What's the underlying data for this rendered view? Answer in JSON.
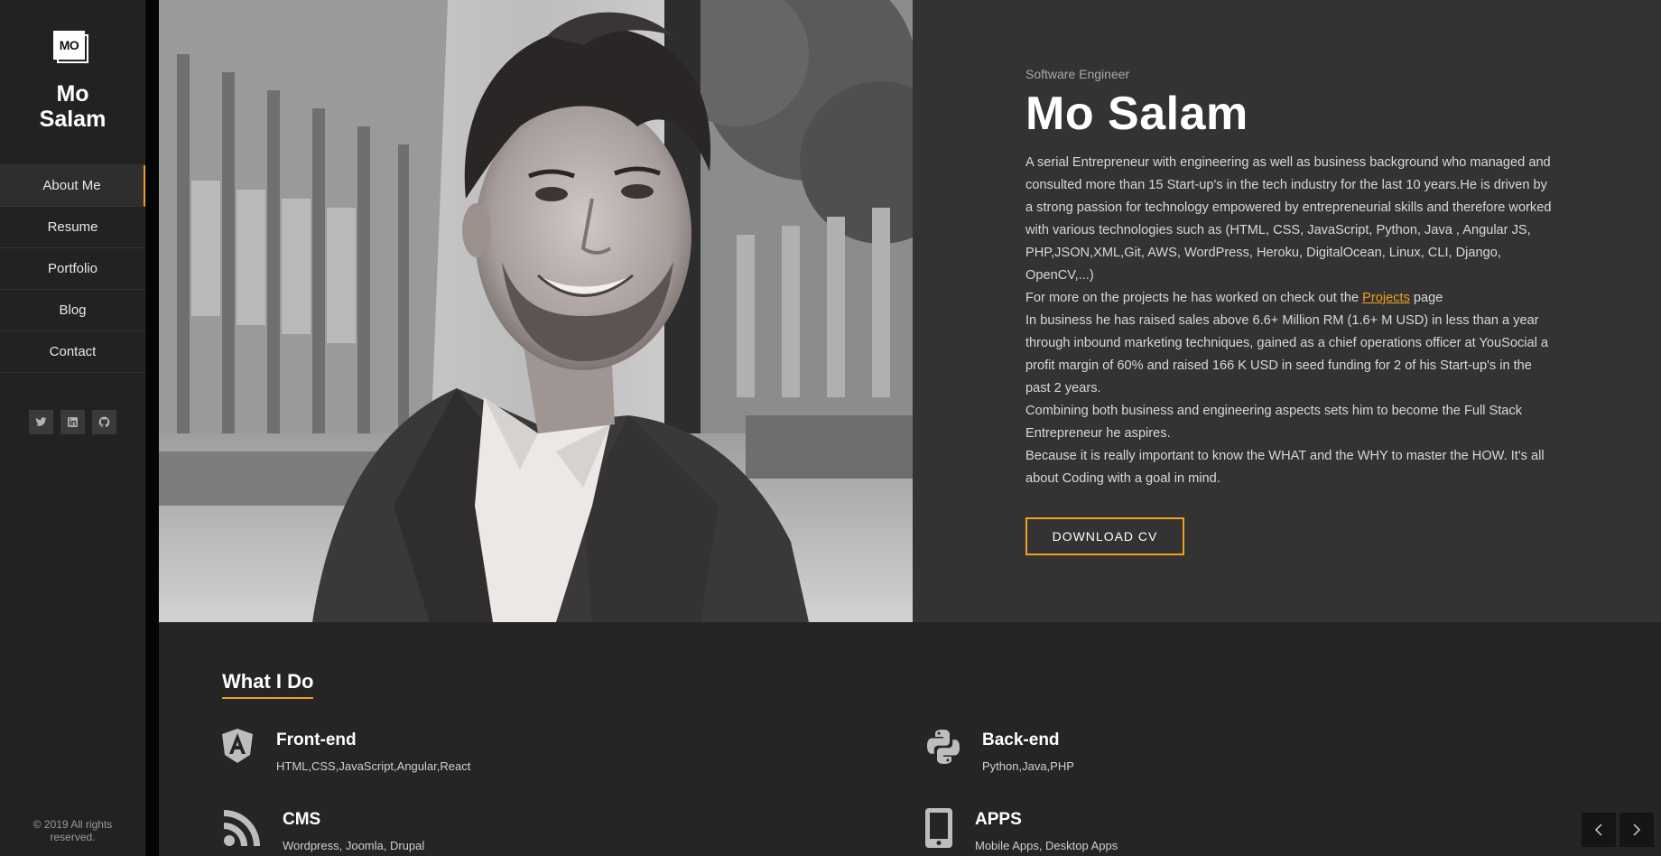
{
  "sidebar": {
    "logo_text": "MO",
    "brand_name": "Mo Salam",
    "nav": [
      {
        "label": "About Me",
        "active": true
      },
      {
        "label": "Resume",
        "active": false
      },
      {
        "label": "Portfolio",
        "active": false
      },
      {
        "label": "Blog",
        "active": false
      },
      {
        "label": "Contact",
        "active": false
      }
    ],
    "socials": [
      {
        "icon": "twitter-icon"
      },
      {
        "icon": "linkedin-icon"
      },
      {
        "icon": "github-icon"
      }
    ],
    "copyright": "© 2019 All rights reserved."
  },
  "hero": {
    "subtitle": "Software Engineer",
    "name": "Mo Salam",
    "bio": {
      "p1": "A serial Entrepreneur with engineering as well as business background who managed and consulted more than 15 Start-up's in the tech industry for the last 10 years.He is driven by a strong passion for technology empowered by entrepreneurial skills and therefore worked with various technologies such as (HTML, CSS, JavaScript, Python, Java , Angular JS, PHP,JSON,XML,Git, AWS, WordPress, Heroku, DigitalOcean, Linux, CLI, Django, OpenCV,...)",
      "p2_before": "For more on the projects he has worked on check out the ",
      "p2_link": "Projects",
      "p2_after": " page",
      "p3": "In business he has raised sales above 6.6+ Million RM (1.6+ M USD) in less than a year through inbound marketing techniques, gained as a chief operations officer at YouSocial a profit margin of 60% and raised 166 K USD in seed funding for 2 of his Start-up's in the past 2 years.",
      "p4": "Combining both business and engineering aspects sets him to become the Full Stack Entrepreneur he aspires.",
      "p5": "Because it is really important to know the WHAT and the WHY to master the HOW. It's all about Coding with a goal in mind."
    },
    "cv_button": "DOWNLOAD CV"
  },
  "services": {
    "title": "What I Do",
    "items": [
      {
        "icon": "angular-icon",
        "title": "Front-end",
        "desc": "HTML,CSS,JavaScript,Angular,React"
      },
      {
        "icon": "python-icon",
        "title": "Back-end",
        "desc": "Python,Java,PHP"
      },
      {
        "icon": "rss-icon",
        "title": "CMS",
        "desc": "Wordpress, Joomla, Drupal"
      },
      {
        "icon": "mobile-icon",
        "title": "APPS",
        "desc": "Mobile Apps, Desktop Apps"
      }
    ]
  },
  "colors": {
    "accent": "#f0a01c",
    "sidebar_bg": "#222222",
    "hero_bg": "#333333",
    "services_bg": "#252525"
  }
}
